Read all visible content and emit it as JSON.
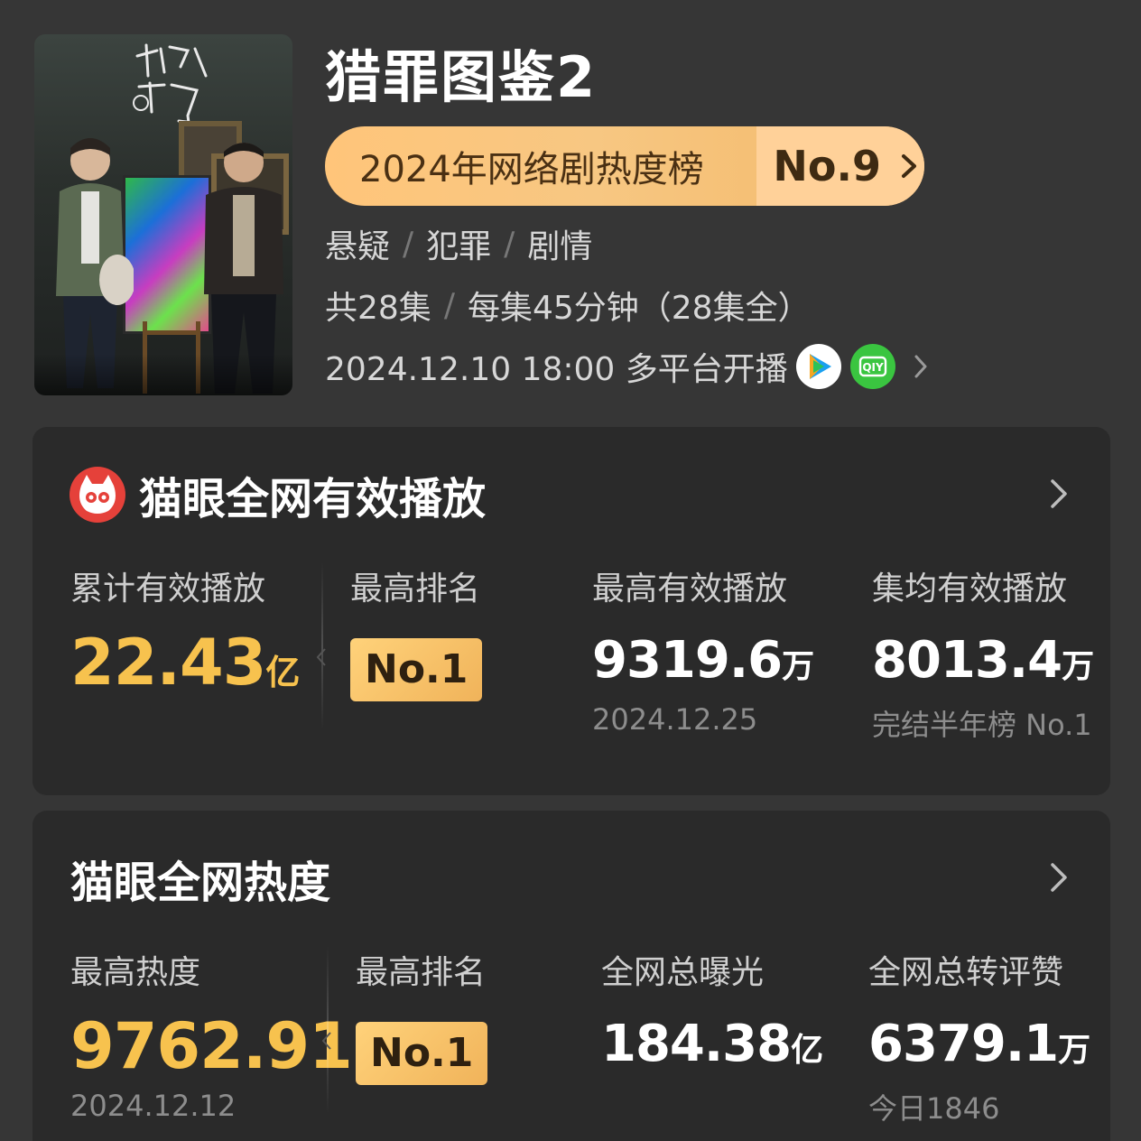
{
  "header": {
    "title": "猎罪图鉴2",
    "rank_label": "2024年网络剧热度榜",
    "rank_value": "No.9",
    "genres": [
      "悬疑",
      "犯罪",
      "剧情"
    ],
    "episodes": "共28集",
    "duration": "每集45分钟（28集全）",
    "airdate": "2024.12.10 18:00 多平台开播",
    "platforms": [
      "tencent-video-icon",
      "iqiyi-icon"
    ]
  },
  "playback": {
    "title": "猫眼全网有效播放",
    "stats": [
      {
        "label": "累计有效播放",
        "value": "22.43",
        "unit": "亿"
      },
      {
        "label": "最高排名",
        "value": "No.1"
      },
      {
        "label": "最高有效播放",
        "value": "9319.6",
        "unit": "万",
        "sub": "2024.12.25"
      },
      {
        "label": "集均有效播放",
        "value": "8013.4",
        "unit": "万",
        "sub": "完结半年榜 No.1"
      }
    ]
  },
  "heat": {
    "title": "猫眼全网热度",
    "stats": [
      {
        "label": "最高热度",
        "value": "9762.91",
        "sub": "2024.12.12"
      },
      {
        "label": "最高排名",
        "value": "No.1"
      },
      {
        "label": "全网总曝光",
        "value": "184.38",
        "unit": "亿"
      },
      {
        "label": "全网总转评赞",
        "value": "6379.1",
        "unit": "万",
        "sub": "今日1846"
      }
    ]
  },
  "colors": {
    "accent_gold": "#f7c24e",
    "background": "#363636",
    "card": "#2a2a2a",
    "maoyan_red": "#e5413a"
  }
}
